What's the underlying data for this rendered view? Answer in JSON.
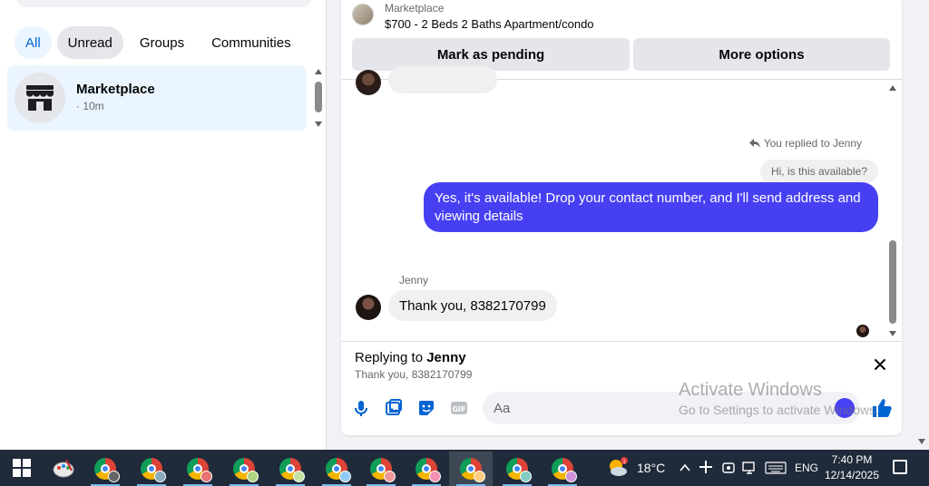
{
  "filters": [
    {
      "label": "All",
      "state": "active"
    },
    {
      "label": "Unread",
      "state": "hover"
    },
    {
      "label": "Groups",
      "state": "plain"
    },
    {
      "label": "Communities",
      "state": "plain"
    }
  ],
  "conversation": {
    "name": "Marketplace",
    "time": "· 10m",
    "icon": "store-icon"
  },
  "header": {
    "source": "Marketplace",
    "listing_title": "$700 - 2 Beds 2 Baths Apartment/condo",
    "pending_label": "Mark as pending",
    "more_label": "More options"
  },
  "messages": {
    "replied_note": "You replied to Jenny",
    "quoted_text": "Hi, is this available?",
    "sent_text": "Yes, it's available! Drop your contact number, and I'll send address and viewing details",
    "sender_name": "Jenny",
    "received_text": "Thank you, 8382170799"
  },
  "reply_bar": {
    "prefix": "Replying to",
    "name": "Jenny",
    "quote": "Thank you, 8382170799"
  },
  "composer": {
    "placeholder": "Aa"
  },
  "watermark": {
    "line1": "Activate Windows",
    "line2": "Go to Settings to activate Windows."
  },
  "colors": {
    "accent": "#4740f3",
    "selected_row": "#ebf5ff",
    "taskbar": "#1f2a3a"
  },
  "taskbar": {
    "weather_temp": "18°C",
    "language": "ENG",
    "time": "7:40 PM",
    "date": "12/14/2025",
    "weather_badge": "1",
    "apps": [
      {
        "icon": "paint-icon"
      },
      {
        "icon": "chrome-icon",
        "badge": "C"
      },
      {
        "icon": "chrome-icon"
      },
      {
        "icon": "chrome-icon"
      },
      {
        "icon": "chrome-icon"
      },
      {
        "icon": "chrome-icon"
      },
      {
        "icon": "chrome-icon"
      },
      {
        "icon": "chrome-icon"
      },
      {
        "icon": "chrome-icon"
      },
      {
        "icon": "chrome-icon"
      },
      {
        "icon": "chrome-icon"
      },
      {
        "icon": "chrome-icon"
      }
    ]
  }
}
